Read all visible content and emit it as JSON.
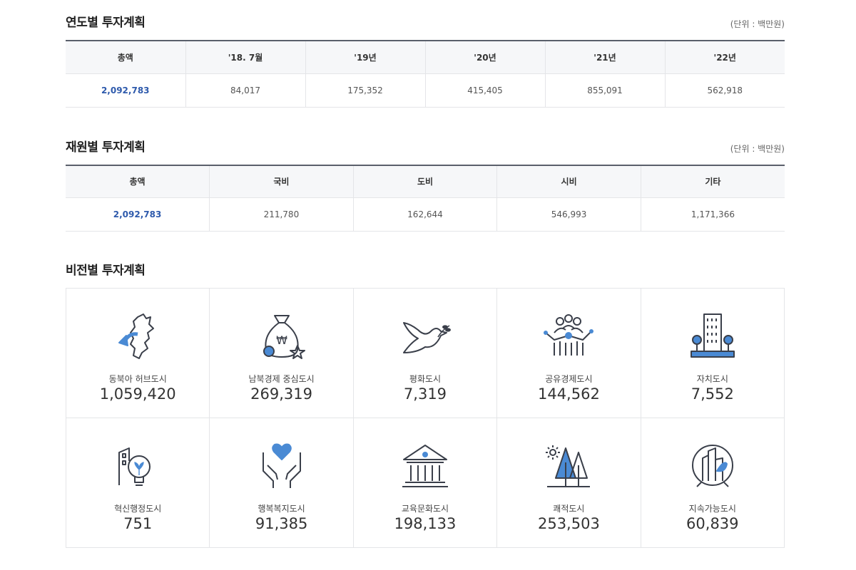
{
  "yearly": {
    "title": "연도별 투자계획",
    "unit": "(단위 : 백만원)",
    "headers": [
      "총액",
      "'18. 7월",
      "'19년",
      "'20년",
      "'21년",
      "'22년"
    ],
    "values": [
      "2,092,783",
      "84,017",
      "175,352",
      "415,405",
      "855,091",
      "562,918"
    ]
  },
  "source": {
    "title": "재원별 투자계획",
    "unit": "(단위 : 백만원)",
    "headers": [
      "총액",
      "국비",
      "도비",
      "시비",
      "기타"
    ],
    "values": [
      "2,092,783",
      "211,780",
      "162,644",
      "546,993",
      "1,171,366"
    ]
  },
  "vision": {
    "title": "비전별 투자계획",
    "items": [
      {
        "label": "동북아 허브도시",
        "value": "1,059,420",
        "icon": "peninsula-arrow-icon"
      },
      {
        "label": "남북경제 중심도시",
        "value": "269,319",
        "icon": "money-bag-icon"
      },
      {
        "label": "평화도시",
        "value": "7,319",
        "icon": "dove-icon"
      },
      {
        "label": "공유경제도시",
        "value": "144,562",
        "icon": "people-network-icon"
      },
      {
        "label": "자치도시",
        "value": "7,552",
        "icon": "building-icon"
      },
      {
        "label": "혁신행정도시",
        "value": "751",
        "icon": "lightbulb-building-icon"
      },
      {
        "label": "행복복지도시",
        "value": "91,385",
        "icon": "hands-heart-icon"
      },
      {
        "label": "교육문화도시",
        "value": "198,133",
        "icon": "museum-icon"
      },
      {
        "label": "쾌적도시",
        "value": "253,503",
        "icon": "trees-sun-icon"
      },
      {
        "label": "지속가능도시",
        "value": "60,839",
        "icon": "sustainable-city-icon"
      }
    ]
  },
  "colors": {
    "accent": "#2e5aac",
    "icon_blue": "#4a8ad4",
    "icon_line": "#3a3f4a"
  }
}
